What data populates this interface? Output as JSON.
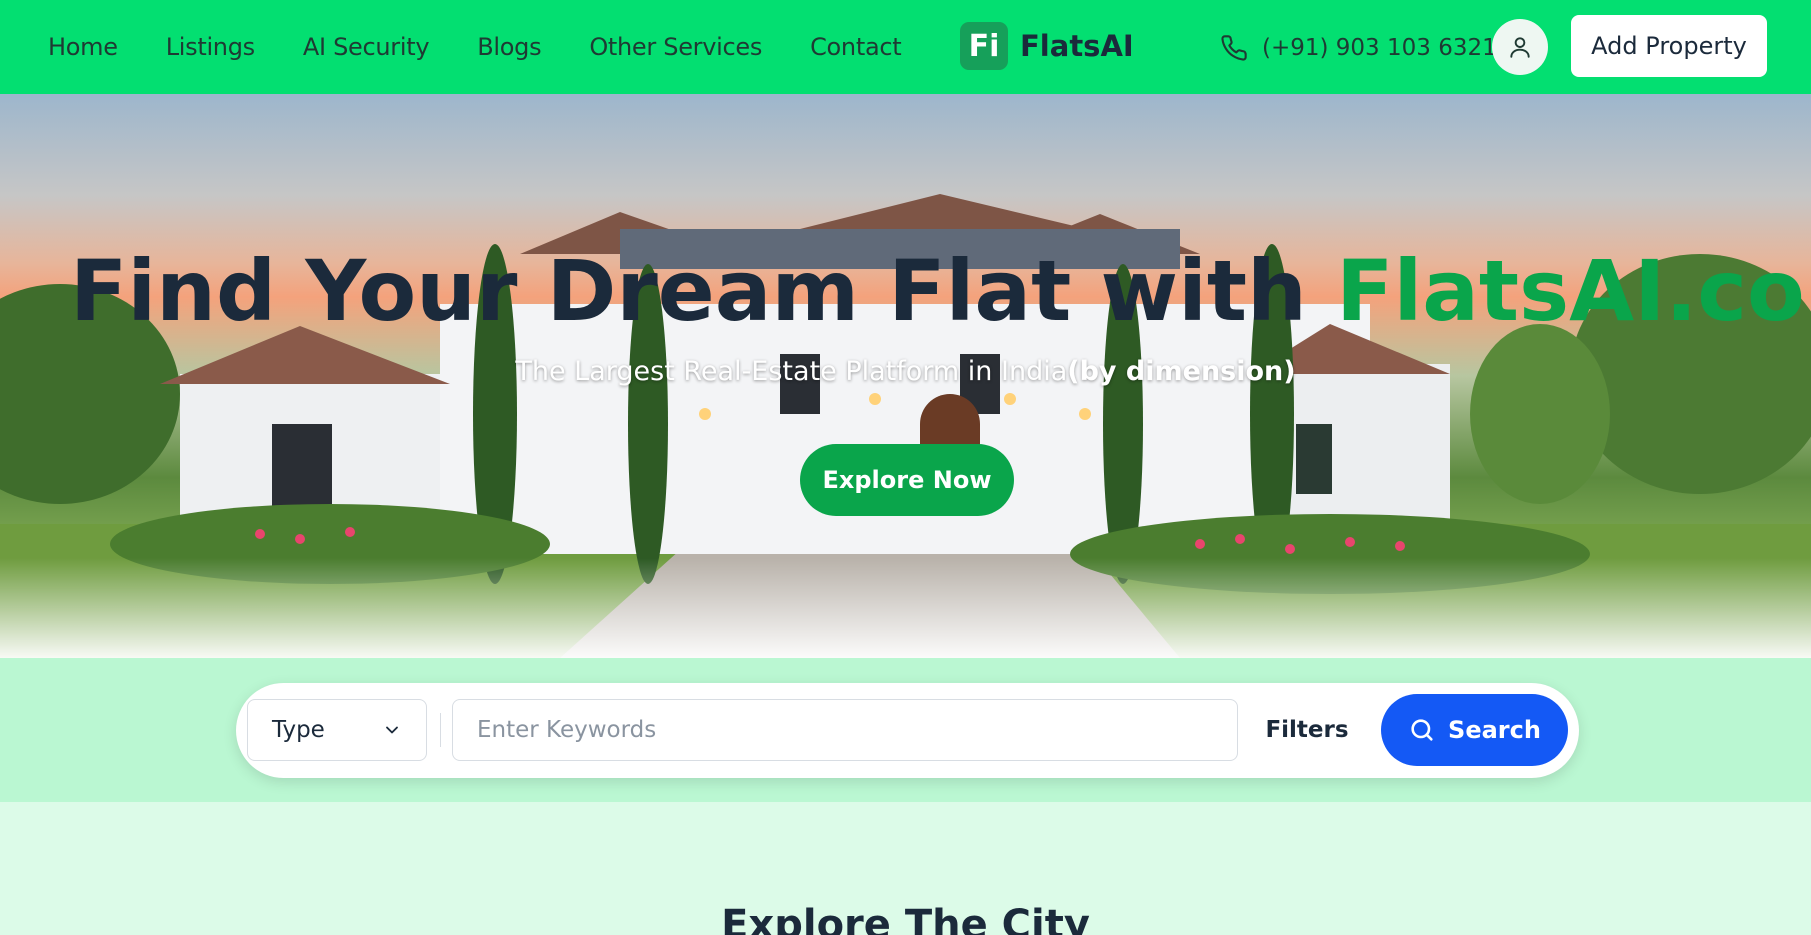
{
  "nav": {
    "items": [
      {
        "label": "Home"
      },
      {
        "label": "Listings"
      },
      {
        "label": "AI Security"
      },
      {
        "label": "Blogs"
      },
      {
        "label": "Other Services"
      },
      {
        "label": "Contact"
      }
    ]
  },
  "brand": {
    "mark": "Fi",
    "name": "FlatsAI"
  },
  "contact": {
    "phone": "(+91) 903 103 6321",
    "phone_icon": "phone-icon"
  },
  "header": {
    "user_icon": "user-icon",
    "add_property_label": "Add Property"
  },
  "hero": {
    "headline_main": "Find Your Dream Flat with ",
    "headline_accent": "FlatsAI.com",
    "subline_main": "The Largest Real-Estate Platform in India",
    "subline_bold": "(by dimension)",
    "cta_label": "Explore Now"
  },
  "search": {
    "type_label": "Type",
    "type_icon": "chevron-down-icon",
    "keywords_placeholder": "Enter Keywords",
    "filters_label": "Filters",
    "search_label": "Search",
    "search_icon": "search-icon"
  },
  "sections": {
    "explore_title": "Explore The City"
  },
  "colors": {
    "header_bg": "#03df71",
    "accent_green": "#0aa54b",
    "search_blue": "#1459f5",
    "band_bg": "#baf7d2",
    "page_bg": "#dcfbe8",
    "text_dark": "#1b2a3b"
  }
}
